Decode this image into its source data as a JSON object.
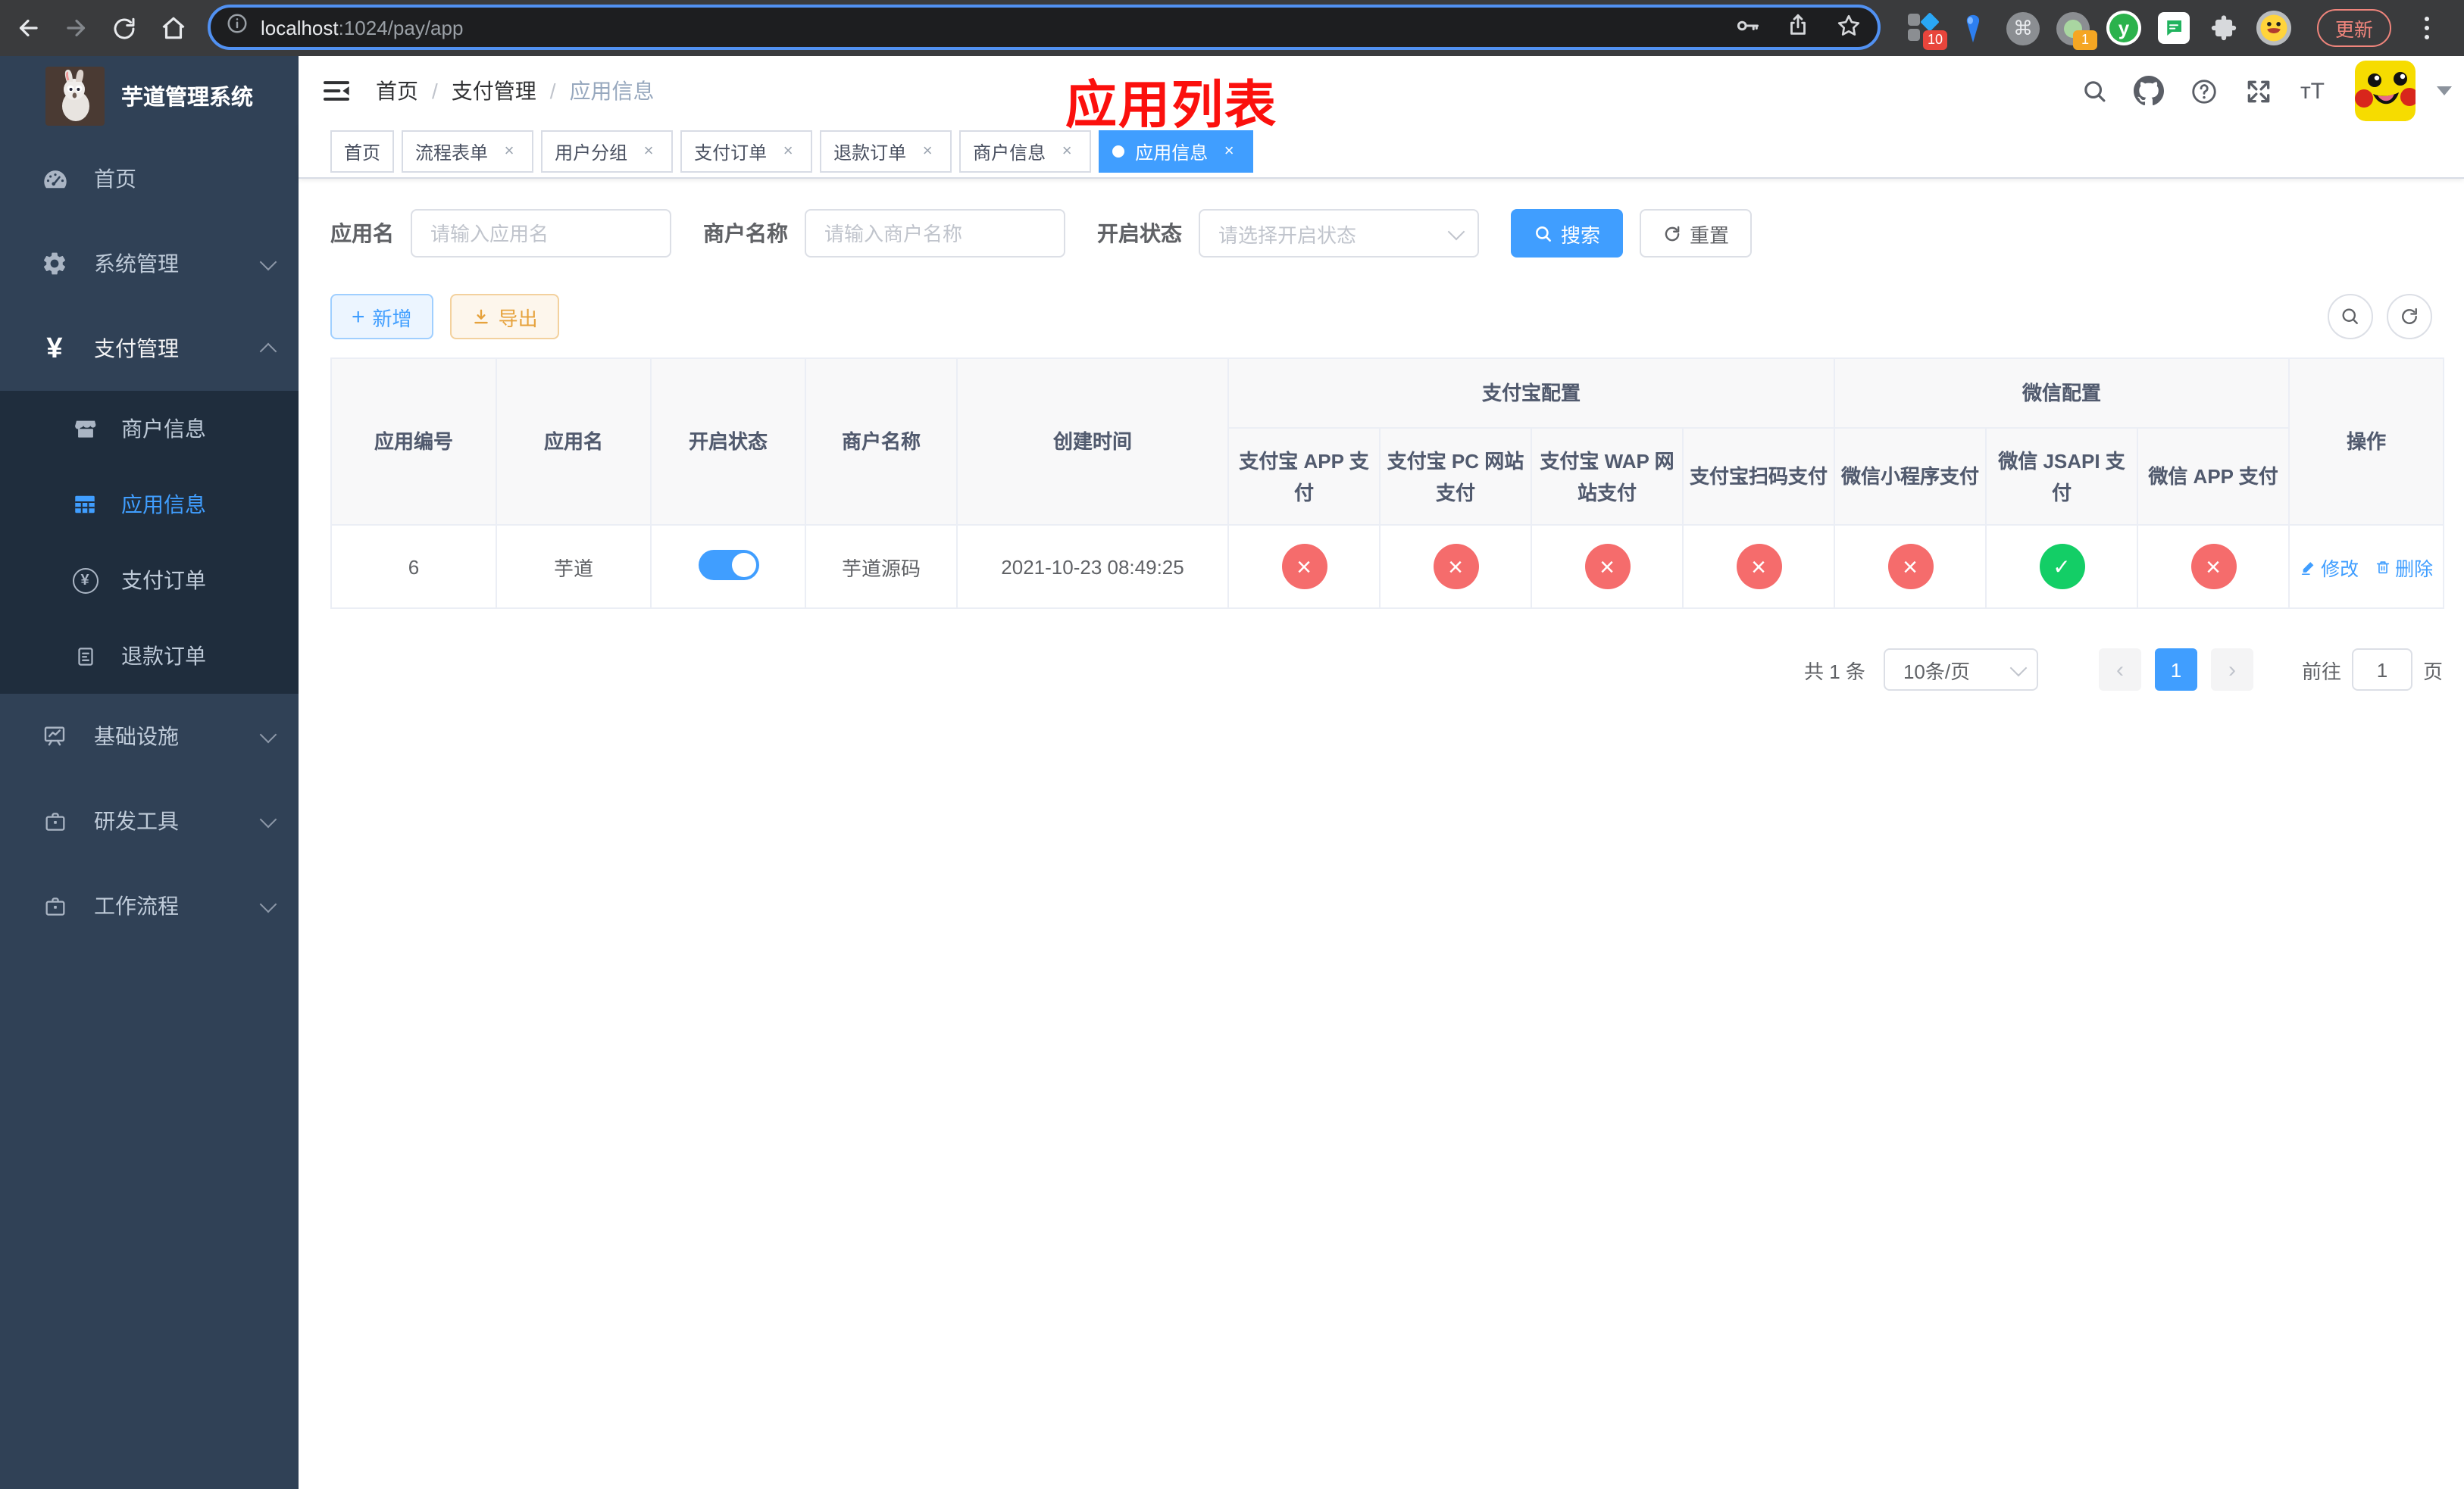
{
  "browser": {
    "url_host": "localhost",
    "url_rest": ":1024/pay/app",
    "update_button": "更新",
    "ext_badge_10": "10",
    "ext_badge_1": "1",
    "ext_y_letter": "y",
    "command_glyph": "⌘"
  },
  "sidebar": {
    "logo_title": "芋道管理系统",
    "items": [
      {
        "label": "首页"
      },
      {
        "label": "系统管理"
      },
      {
        "label": "支付管理"
      },
      {
        "label": "基础设施"
      },
      {
        "label": "研发工具"
      },
      {
        "label": "工作流程"
      }
    ],
    "submenu": [
      {
        "label": "商户信息"
      },
      {
        "label": "应用信息"
      },
      {
        "label": "支付订单"
      },
      {
        "label": "退款订单"
      }
    ]
  },
  "header": {
    "breadcrumb": {
      "home": "首页",
      "section": "支付管理",
      "current": "应用信息",
      "separator": "/"
    },
    "font_icon_glyph": "тT",
    "annotation": "应用列表"
  },
  "tabs": [
    {
      "label": "首页"
    },
    {
      "label": "流程表单"
    },
    {
      "label": "用户分组"
    },
    {
      "label": "支付订单"
    },
    {
      "label": "退款订单"
    },
    {
      "label": "商户信息"
    },
    {
      "label": "应用信息"
    }
  ],
  "filters": {
    "app_name_label": "应用名",
    "app_name_placeholder": "请输入应用名",
    "merchant_label": "商户名称",
    "merchant_placeholder": "请输入商户名称",
    "status_label": "开启状态",
    "status_placeholder": "请选择开启状态",
    "search_button": "搜索",
    "reset_button": "重置"
  },
  "toolbar": {
    "add_button": "新增",
    "export_button": "导出"
  },
  "table": {
    "columns": {
      "id": "应用编号",
      "name": "应用名",
      "status": "开启状态",
      "merchant": "商户名称",
      "created": "创建时间",
      "alipay_group": "支付宝配置",
      "wechat_group": "微信配置",
      "alipay_app": "支付宝 APP 支付",
      "alipay_pc": "支付宝 PC 网站支付",
      "alipay_wap": "支付宝 WAP 网站支付",
      "alipay_qr": "支付宝扫码支付",
      "wx_lite": "微信小程序支付",
      "wx_jsapi": "微信 JSAPI 支付",
      "wx_app": "微信 APP 支付",
      "actions": "操作"
    },
    "rows": [
      {
        "id": "6",
        "name": "芋道",
        "switch": "on",
        "merchant": "芋道源码",
        "created": "2021-10-23 08:49:25",
        "statuses": [
          "no",
          "no",
          "no",
          "no",
          "no",
          "yes",
          "no"
        ],
        "edit_link": "修改",
        "delete_link": "删除"
      }
    ]
  },
  "pagination": {
    "total": "共 1 条",
    "page_size": "10条/页",
    "prev": "‹",
    "page": "1",
    "next": "›",
    "goto_label": "前往",
    "goto_value": "1",
    "goto_unit": "页"
  },
  "colors": {
    "primary": "#409eff",
    "success": "#13ce66",
    "danger": "#f56c6c",
    "warning": "#e6a23c",
    "sidebar_bg": "#304156",
    "submenu_bg": "#1f2d3d",
    "annotation": "#fb100d"
  }
}
